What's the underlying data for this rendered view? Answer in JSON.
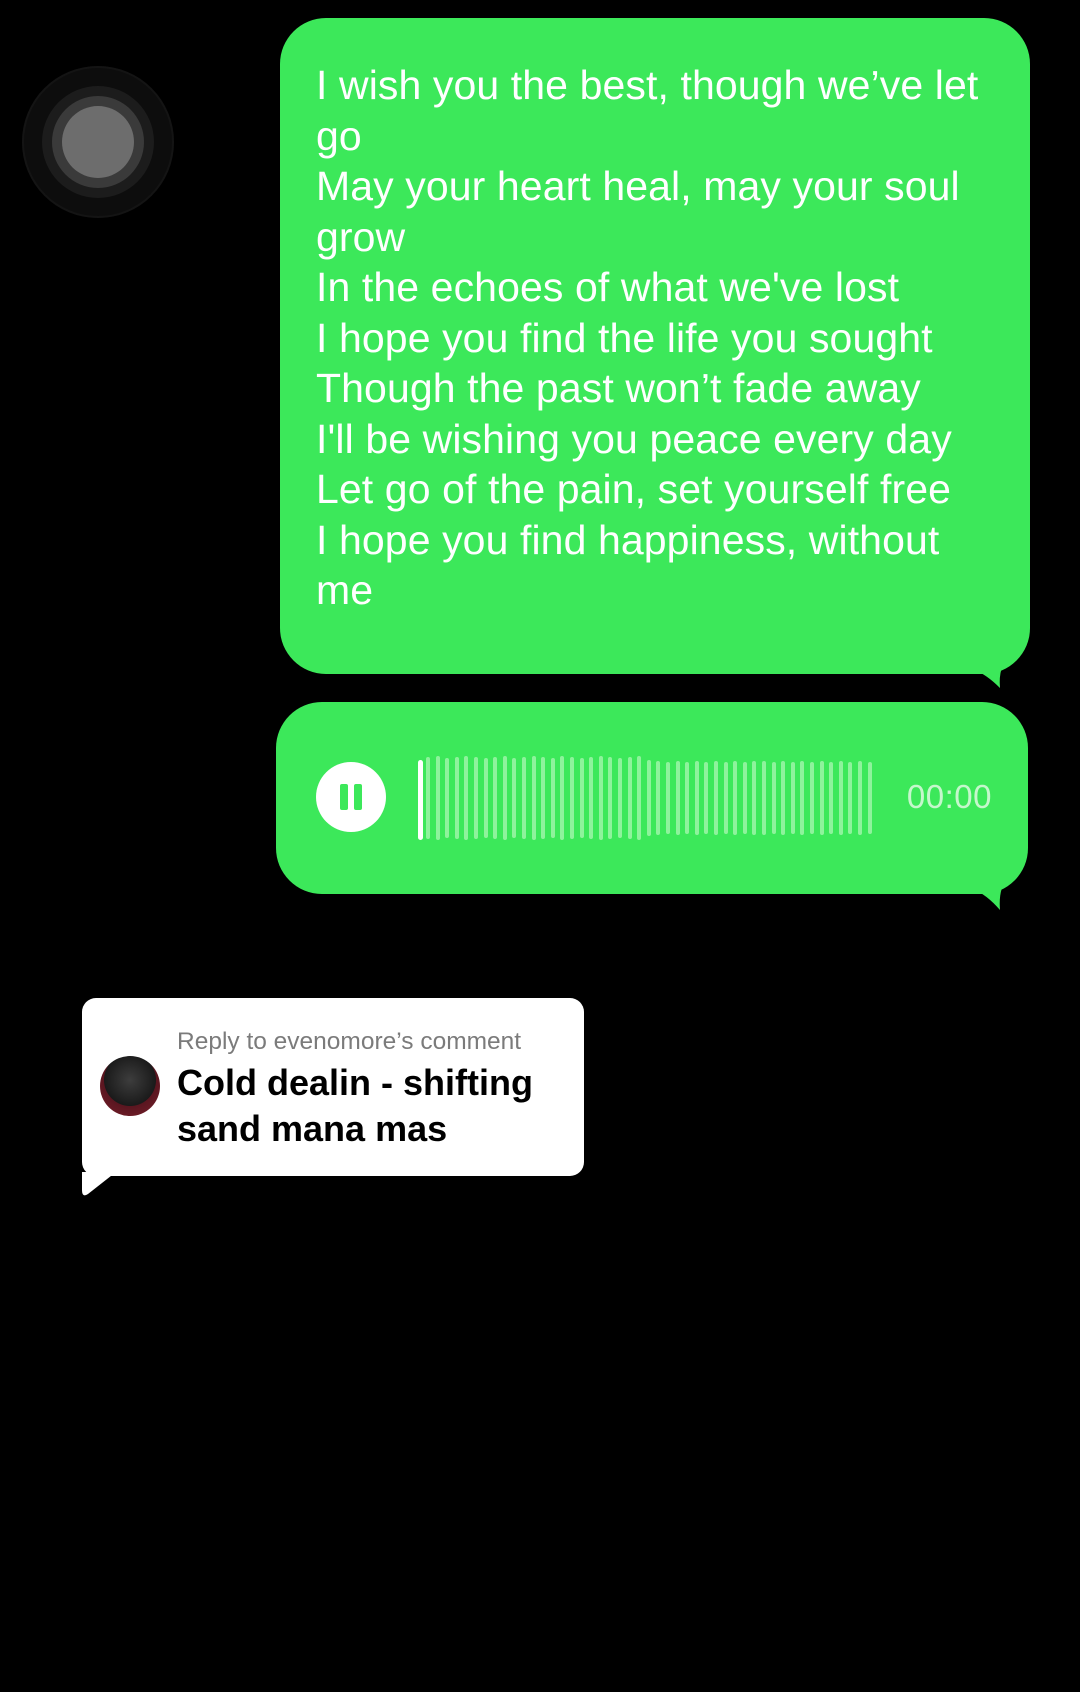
{
  "message": {
    "lyrics": "I wish you the best, though we’ve let go\nMay your heart heal, may your soul grow\nIn the echoes of what we've lost\nI hope you find the life you sought\nThough the past won’t fade away\nI'll be wishing you peace every day\nLet go of the pain, set yourself free\nI hope you find happiness, without me"
  },
  "audio": {
    "state_icon": "pause-icon",
    "time": "00:00",
    "progress": 0
  },
  "reply": {
    "label": "Reply to evenomore’s comment",
    "comment": "Cold dealin - shifting sand mana mas"
  },
  "colors": {
    "bubble": "#3ce85a",
    "background": "#000000",
    "card": "#ffffff"
  }
}
